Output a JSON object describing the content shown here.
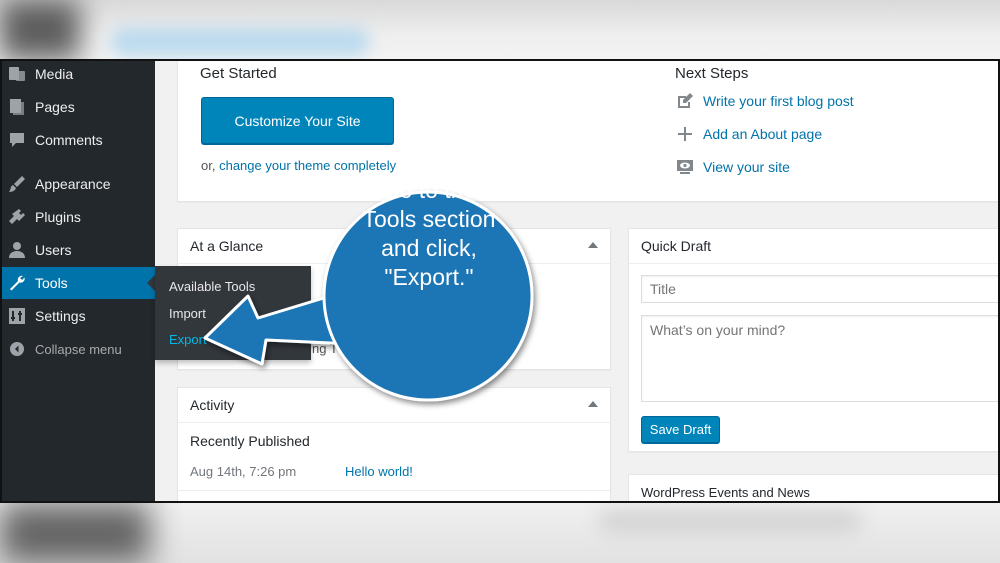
{
  "sidebar": {
    "items": [
      {
        "label": "Media",
        "icon": "media-icon"
      },
      {
        "label": "Pages",
        "icon": "pages-icon"
      },
      {
        "label": "Comments",
        "icon": "comments-icon"
      },
      {
        "label": "Appearance",
        "icon": "appearance-icon"
      },
      {
        "label": "Plugins",
        "icon": "plugins-icon"
      },
      {
        "label": "Users",
        "icon": "users-icon"
      },
      {
        "label": "Tools",
        "icon": "tools-icon",
        "active": true
      },
      {
        "label": "Settings",
        "icon": "settings-icon"
      }
    ],
    "collapse_label": "Collapse menu",
    "submenu": {
      "items": [
        "Available Tools",
        "Import",
        "Export"
      ],
      "current": "Export"
    }
  },
  "welcome": {
    "get_started_title": "Get Started",
    "customize_button": "Customize Your Site",
    "or_text": "or,",
    "change_theme_link": "change your theme completely",
    "next_steps_title": "Next Steps",
    "next_steps": [
      {
        "label": "Write your first blog post",
        "icon": "edit-icon"
      },
      {
        "label": "Add an About page",
        "icon": "plus-icon"
      },
      {
        "label": "View your site",
        "icon": "view-site-icon"
      }
    ]
  },
  "at_a_glance": {
    "title": "At a Glance",
    "partial_text": "ng T"
  },
  "activity": {
    "title": "Activity",
    "recently_published": "Recently Published",
    "date": "Aug 14th, 7:26 pm",
    "post_link": "Hello world!"
  },
  "quick_draft": {
    "title": "Quick Draft",
    "title_placeholder": "Title",
    "content_placeholder": "What’s on your mind?",
    "save_button": "Save Draft"
  },
  "events": {
    "title": "WordPress Events and News"
  },
  "callout": {
    "lines": [
      "Go to the",
      "Tools section",
      "and click,",
      "\"Export.\""
    ],
    "color": "#1b75b5"
  },
  "colors": {
    "sidebar_bg": "#23282d",
    "accent": "#0073aa",
    "button": "#0085ba"
  }
}
